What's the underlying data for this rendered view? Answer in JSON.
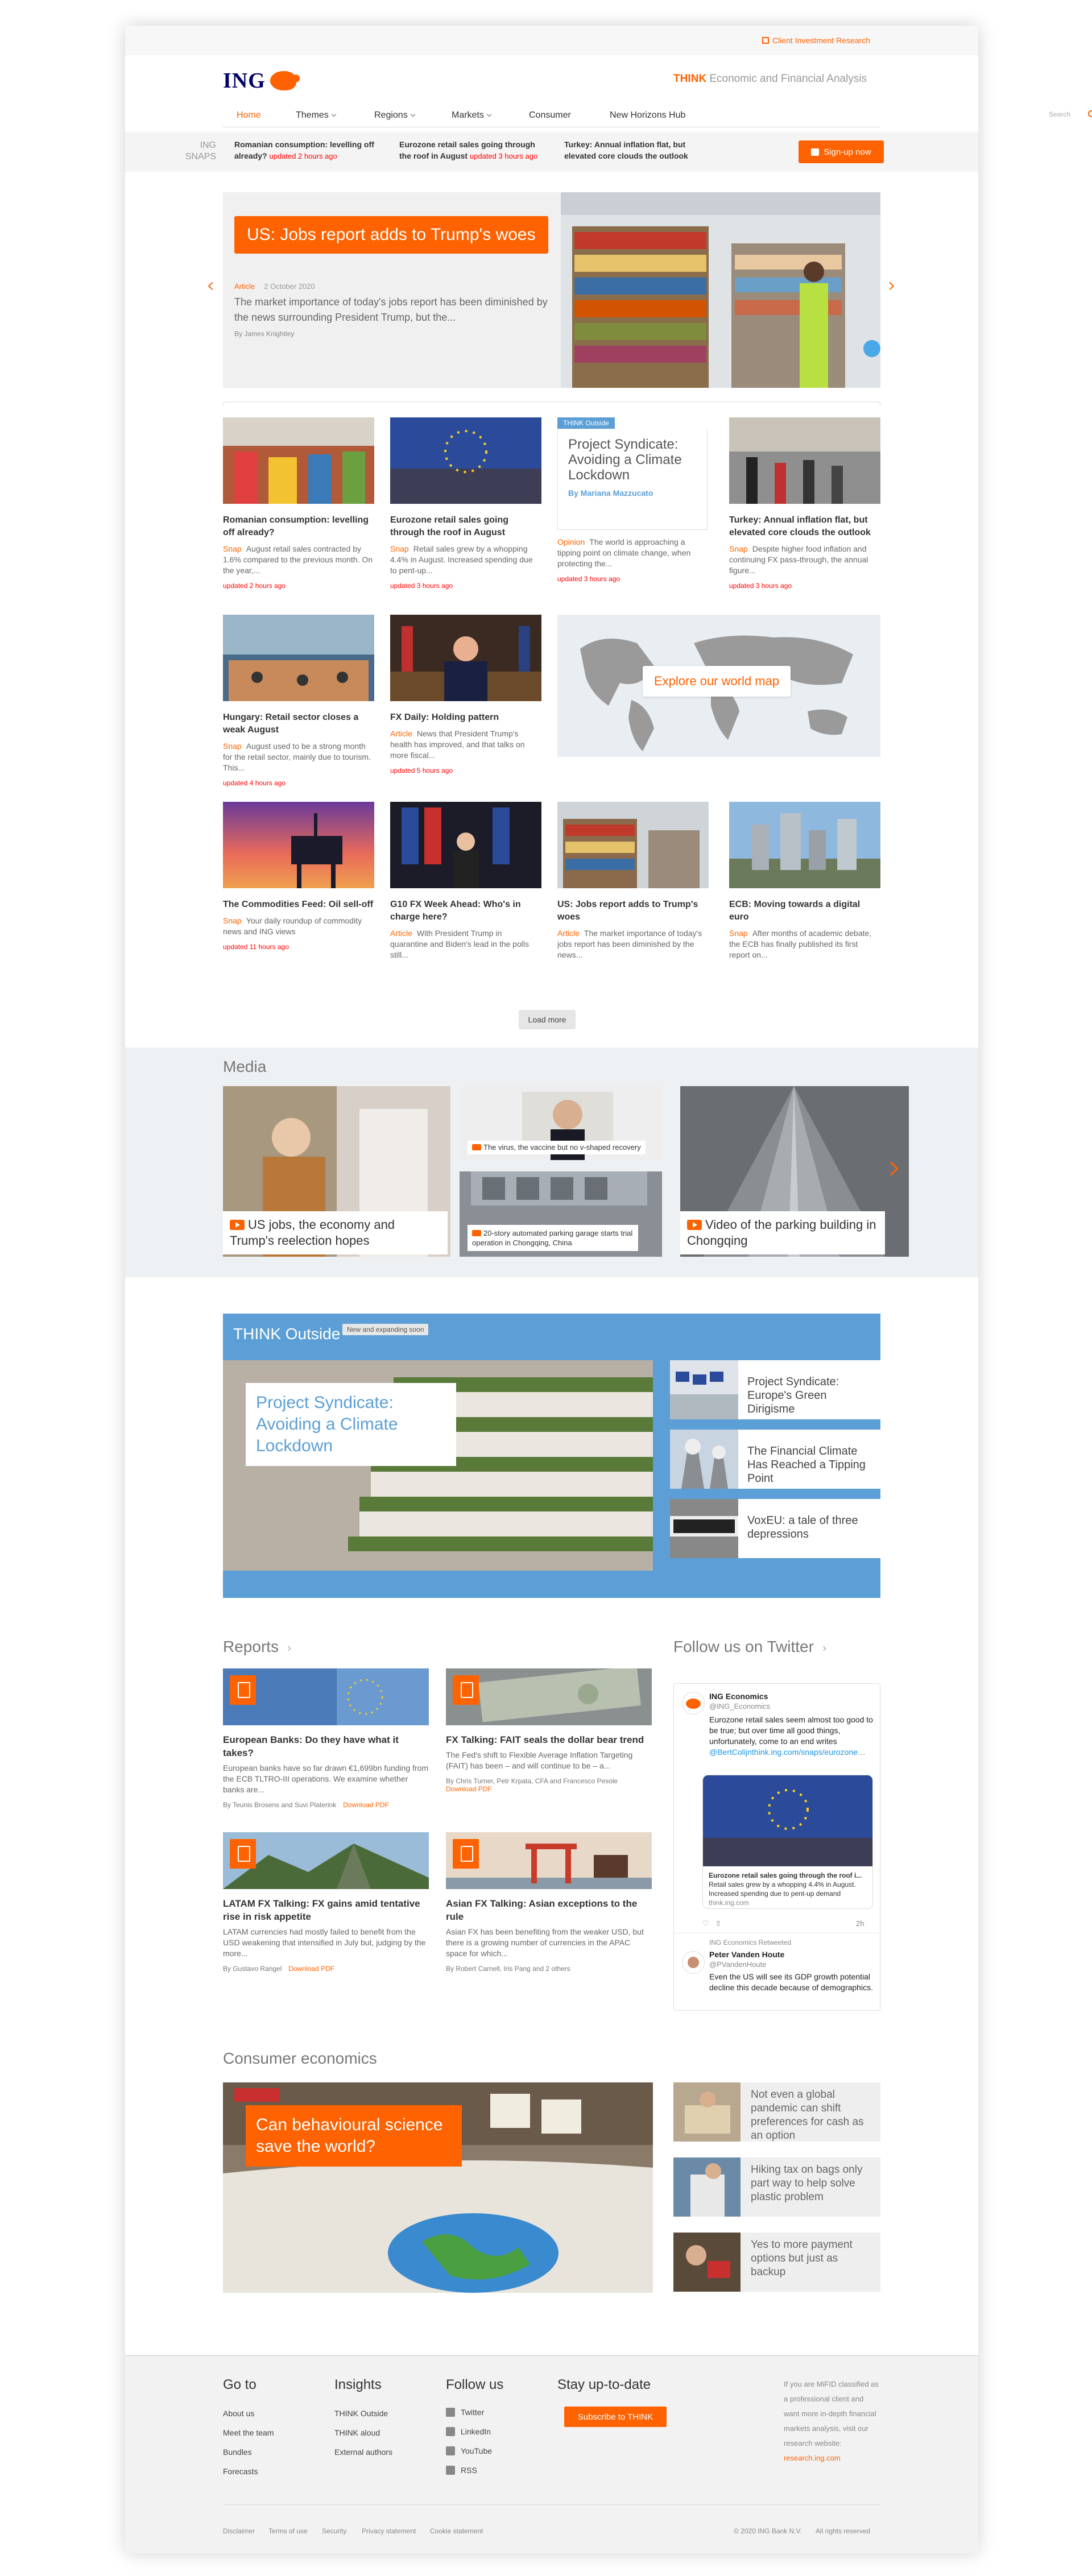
{
  "topbar": {
    "client_link": "Client Investment Research"
  },
  "header": {
    "logo_text": "ING",
    "tagline_brand": "THINK",
    "tagline_rest": "Economic and Financial Analysis"
  },
  "nav": {
    "items": [
      {
        "label": "Home"
      },
      {
        "label": "Themes"
      },
      {
        "label": "Regions"
      },
      {
        "label": "Markets"
      },
      {
        "label": "Consumer"
      },
      {
        "label": "New Horizons Hub"
      }
    ],
    "search_placeholder": "Search"
  },
  "snaps": {
    "label_line1": "ING",
    "label_line2": "SNAPS",
    "items": [
      {
        "title": "Romanian consumption: levelling off already?",
        "updated": "updated 2 hours ago"
      },
      {
        "title": "Eurozone retail sales going through the roof in August",
        "updated": "updated 3 hours ago"
      },
      {
        "title": "Turkey: Annual inflation flat, but elevated core clouds the outlook",
        "updated": ""
      }
    ],
    "signup_label": "Sign-up now"
  },
  "hero": {
    "title": "US: Jobs report adds to Trump's woes",
    "tag": "Article",
    "date": "2 October 2020",
    "summary": "The market importance of today's jobs report has been diminished by the news surrounding President Trump, but the...",
    "author": "By James Knightley"
  },
  "cards": [
    {
      "title": "Romanian consumption: levelling off already?",
      "tag": "Snap",
      "excerpt": "August retail sales contracted by 1.6% compared to the previous month. On the year,...",
      "updated": "updated 2 hours ago"
    },
    {
      "title": "Eurozone retail sales going through the roof in August",
      "tag": "Snap",
      "excerpt": "Retail sales grew by a whopping 4.4% in August. Increased spending due to pent-up...",
      "updated": "updated 3 hours ago"
    },
    {
      "title": "Turkey: Annual inflation flat, but elevated core clouds the outlook",
      "tag": "Snap",
      "excerpt": "Despite higher food inflation and continuing FX pass-through, the annual figure...",
      "updated": "updated 3 hours ago"
    },
    {
      "title": "Hungary: Retail sector closes a weak August",
      "tag": "Snap",
      "excerpt": "August used to be a strong month for the retail sector, mainly due to tourism. This...",
      "updated": "updated 4 hours ago"
    },
    {
      "title": "FX Daily: Holding pattern",
      "tag": "Article",
      "excerpt": "News that President Trump's health has improved, and that talks on more fiscal...",
      "updated": "updated 5 hours ago"
    },
    {
      "title": "The Commodities Feed: Oil sell-off",
      "tag": "Snap",
      "excerpt": "Your daily roundup of commodity news and ING views",
      "updated": "updated 11 hours ago"
    },
    {
      "title": "G10 FX Week Ahead: Who's in charge here?",
      "tag": "Article",
      "excerpt": "With President Trump in quarantine and Biden's lead in the polls still...",
      "updated": ""
    },
    {
      "title": "US: Jobs report adds to Trump's woes",
      "tag": "Article",
      "excerpt": "The market importance of today's jobs report has been diminished by the news...",
      "updated": ""
    },
    {
      "title": "ECB: Moving towards a digital euro",
      "tag": "Snap",
      "excerpt": "After months of academic debate, the ECB has finally published its first report on...",
      "updated": ""
    }
  ],
  "opinion": {
    "badge": "THINK Outside",
    "title": "Project Syndicate: Avoiding a Climate Lockdown",
    "author": "By Mariana Mazzucato",
    "tag": "Opinion",
    "excerpt": "The world is approaching a tipping point on climate change, when protecting the...",
    "updated": "updated 3 hours ago"
  },
  "worldmap": {
    "button": "Explore our world map"
  },
  "load_more": "Load more",
  "media": {
    "title": "Media",
    "items": [
      {
        "caption": "US jobs, the economy and Trump's reelection hopes"
      },
      {
        "caption": "The virus, the vaccine but no v-shaped recovery"
      },
      {
        "caption": "20-story automated parking garage starts trial operation in Chongqing, China"
      },
      {
        "caption": "Video of the parking building in Chongqing"
      }
    ]
  },
  "think_outside": {
    "title": "THINK Outside",
    "new_badge": "New and expanding soon",
    "main_caption": "Project Syndicate: Avoiding a Climate Lockdown",
    "items": [
      {
        "title": "Project Syndicate: Europe's Green Dirigisme"
      },
      {
        "title": "The Financial Climate Has Reached a Tipping Point"
      },
      {
        "title": "VoxEU: a tale of three depressions"
      }
    ]
  },
  "reports": {
    "title": "Reports",
    "items": [
      {
        "title": "European Banks: Do they have what it takes?",
        "excerpt": "European banks have so far drawn €1,699bn funding from the ECB TLTRO-III operations. We examine whether banks are...",
        "by": "By Teunis Brosens and Suvi Platerink",
        "download": "Download PDF"
      },
      {
        "title": "FX Talking: FAIT seals the dollar bear trend",
        "excerpt": "The Fed's shift to Flexible Average Inflation Targeting (FAIT) has been – and will continue to be – a...",
        "by": "By Chris Turner, Petr Krpata, CFA and Francesco Pesole",
        "download": "Download PDF"
      },
      {
        "title": "LATAM FX Talking: FX gains amid tentative rise in risk appetite",
        "excerpt": "LATAM currencies had mostly failed to benefit from the USD weakening that intensified in July but, judging by the more...",
        "by": "By Gustavo Rangel",
        "download": "Download PDF"
      },
      {
        "title": "Asian FX Talking: Asian exceptions to the rule",
        "excerpt": "Asian FX has been benefiting from the weaker USD, but there is a growing number of currencies in the APAC space for which...",
        "by": "By Robert Carnell, Iris Pang and 2 others",
        "download": ""
      }
    ]
  },
  "twitter": {
    "title": "Follow us on Twitter",
    "tweet1": {
      "name": "ING Economics",
      "handle": "@ING_Economics",
      "text": "Eurozone retail sales seem almost too good to be true; but over time all good things, unfortunately, come to an end writes",
      "link": "@BertColijnthink.ing.com/snaps/eurozone…",
      "card_title": "Eurozone retail sales going through the roof i...",
      "card_text": "Retail sales grew by a whopping 4.4% in August. Increased spending due to pent-up demand",
      "card_domain": "think.ing.com",
      "time": "2h"
    },
    "retweet_label": "ING Economics Retweeted",
    "tweet2": {
      "name": "Peter Vanden Houte",
      "handle": "@PVandenHoute",
      "text": "Even the US will see its GDP growth potential decline this decade because of demographics."
    }
  },
  "consumer": {
    "title": "Consumer economics",
    "main_caption": "Can behavioural science save the world?",
    "items": [
      {
        "title": "Not even a global pandemic can shift preferences for cash as an option"
      },
      {
        "title": "Hiking tax on bags only part way to help solve plastic problem"
      },
      {
        "title": "Yes to more payment options but just as backup"
      }
    ]
  },
  "footer": {
    "goto_title": "Go to",
    "goto_links": [
      "About us",
      "Meet the team",
      "Bundles",
      "Forecasts"
    ],
    "insights_title": "Insights",
    "insights_links": [
      "THINK Outside",
      "THINK aloud",
      "External authors"
    ],
    "follow_title": "Follow us",
    "follow_links": [
      "Twitter",
      "LinkedIn",
      "YouTube",
      "RSS"
    ],
    "uptodate_title": "Stay up-to-date",
    "subscribe": "Subscribe to THINK",
    "mifid_text": "If you are MiFID classified as a professional client and want more in-depth financial markets analysis, visit our research website:",
    "mifid_link": "research.ing.com",
    "bottom_links": [
      "Disclaimer",
      "Terms of use",
      "Security",
      "Privacy statement",
      "Cookie statement"
    ],
    "copyright": "© 2020 ING Bank N.V.",
    "rights": "All rights reserved"
  }
}
